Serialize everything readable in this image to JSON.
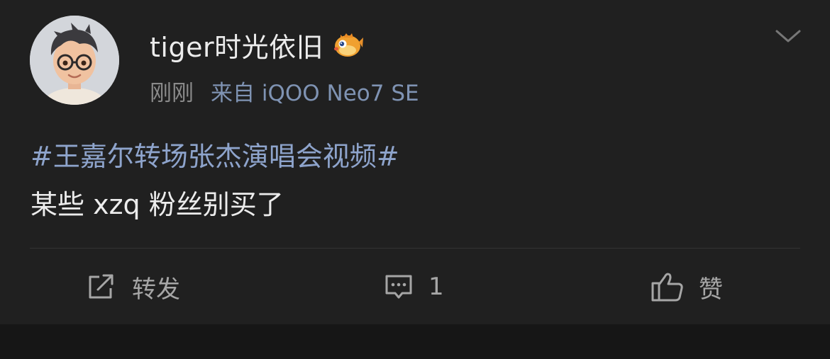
{
  "post": {
    "username": "tiger时光依旧",
    "timestamp": "刚刚",
    "device": "来自 iQOO Neo7 SE",
    "hashtag": "#王嘉尔转场张杰演唱会视频#",
    "content": "某些 xzq 粉丝别买了"
  },
  "actions": {
    "repost_label": "转发",
    "comment_count": "1",
    "like_label": "赞"
  },
  "icons": {
    "avatar": "cartoon-boy-avatar",
    "badge": "pufferfish-badge-icon",
    "menu": "chevron-down-icon",
    "repost": "share-out-icon",
    "comment": "comment-bubble-icon",
    "like": "thumbs-up-icon"
  },
  "colors": {
    "background": "#202020",
    "link": "#8ea4cc",
    "text": "#ececec",
    "muted": "#8a8a8a"
  }
}
